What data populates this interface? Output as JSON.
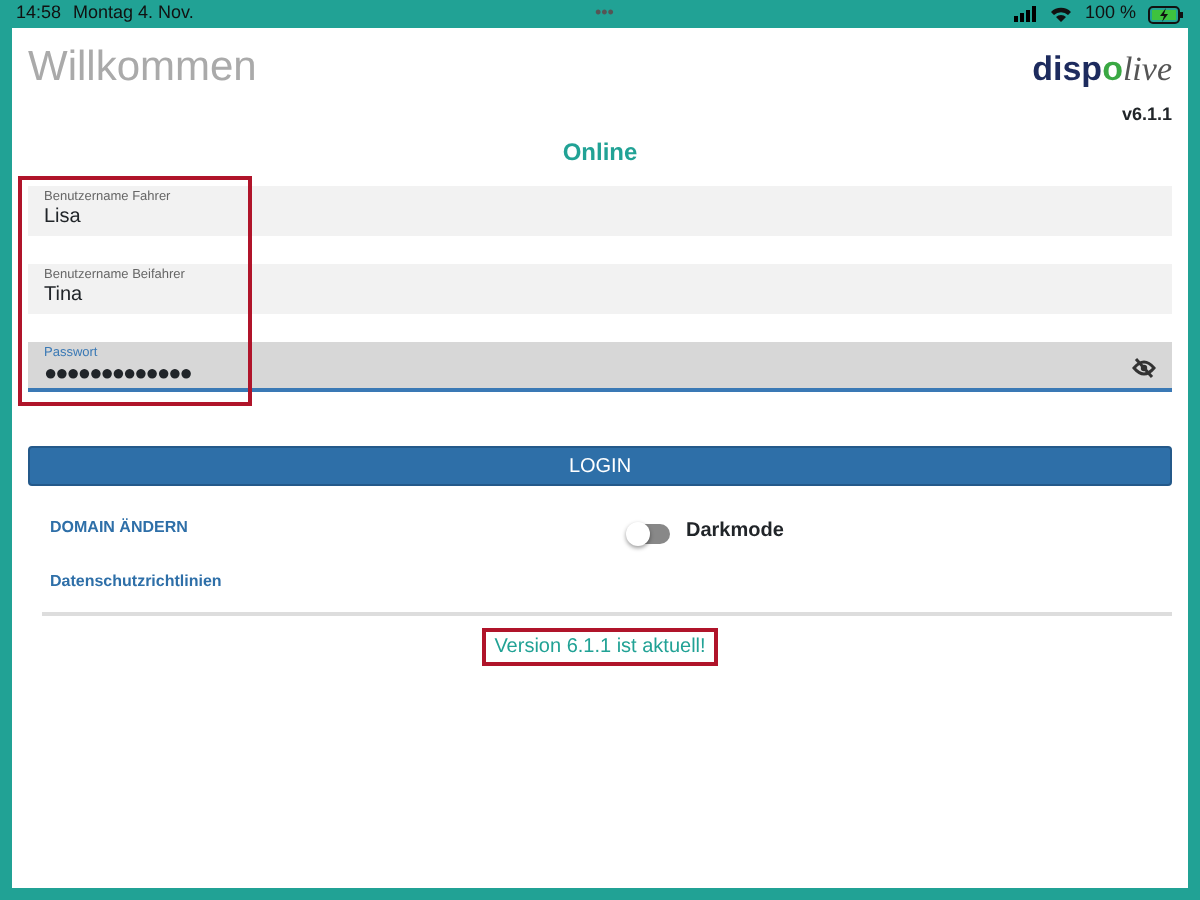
{
  "status_bar": {
    "time": "14:58",
    "date": "Montag 4. Nov.",
    "dots": "•••",
    "battery": "100 %",
    "charging": true
  },
  "title": "Willkommen",
  "logo": {
    "main": "disp",
    "accent": "o",
    "tail": "live"
  },
  "version_label": "v6.1.1",
  "connection": "Online",
  "fields": [
    {
      "label": "Benutzername Fahrer",
      "value": "Lisa",
      "focused": false,
      "kind": "text"
    },
    {
      "label": "Benutzername Beifahrer",
      "value": "Tina",
      "focused": false,
      "kind": "text"
    },
    {
      "label": "Passwort",
      "value": "●●●●●●●●●●●●●",
      "focused": true,
      "kind": "password"
    }
  ],
  "fields_highlighted": true,
  "login_button": "LOGIN",
  "links": [
    "DOMAIN ÄNDERN",
    "Datenschutzrichtlinien"
  ],
  "darkmode": {
    "label": "Darkmode",
    "on": false
  },
  "update_message": {
    "text": "Version 6.1.1 ist aktuell!",
    "highlighted": true
  }
}
